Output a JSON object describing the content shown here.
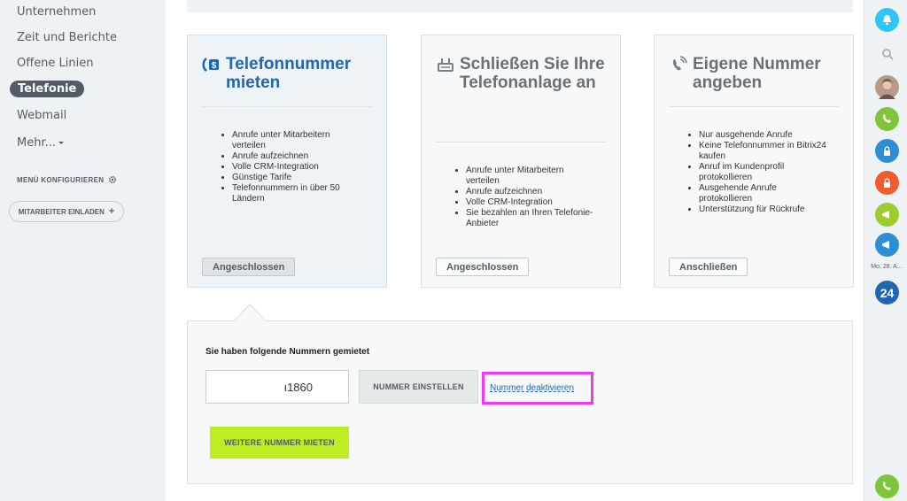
{
  "sidebar": {
    "items": [
      {
        "label": "Unternehmen"
      },
      {
        "label": "Zeit und Berichte"
      },
      {
        "label": "Offene Linien"
      },
      {
        "label": "Telefonie"
      },
      {
        "label": "Webmail"
      },
      {
        "label": "Mehr..."
      }
    ],
    "menu_config_label": "MENÜ KONFIGURIEREN",
    "invite_label": "MITARBEITER EINLADEN"
  },
  "cards": [
    {
      "title": "Telefonnummer mieten",
      "icon": "dollar-phone-icon",
      "features": [
        "Anrufe unter Mitarbeitern verteilen",
        "Anrufe aufzeichnen",
        "Volle CRM-Integration",
        "Günstige Tarife",
        "Telefonnummern in über 50 Ländern"
      ],
      "button": "Angeschlossen"
    },
    {
      "title": "Schließen Sie Ihre Telefonanlage an",
      "icon": "pbx-icon",
      "features": [
        "Anrufe unter Mitarbeitern verteilen",
        "Anrufe aufzeichnen",
        "Volle CRM-Integration",
        "Sie bezahlen an Ihren Telefonie-Anbieter"
      ],
      "button": "Angeschlossen"
    },
    {
      "title": "Eigene Nummer angeben",
      "icon": "phone-icon",
      "features": [
        "Nur ausgehende Anrufe",
        "Keine Telefonnummer in Bitrix24 kaufen",
        "Anruf im Kundenprofil protokollieren",
        "Ausgehende Anrufe protokollieren",
        "Unterstützung für Rückrufe"
      ],
      "button": "Anschließen"
    }
  ],
  "rented": {
    "title": "Sie haben folgende Nummern gemietet",
    "number": "ı1860",
    "set_button": "NUMMER EINSTELLEN",
    "deactivate_link": "Nummer deaktivieren",
    "rent_more_button": "WEITERE NUMMER MIETEN"
  },
  "rightbar": {
    "date": "Mo, 28. A...",
    "badge": "24"
  },
  "colors": {
    "accent_blue": "#2067b0",
    "green_button": "#bbed21",
    "highlight": "#f239f2"
  }
}
